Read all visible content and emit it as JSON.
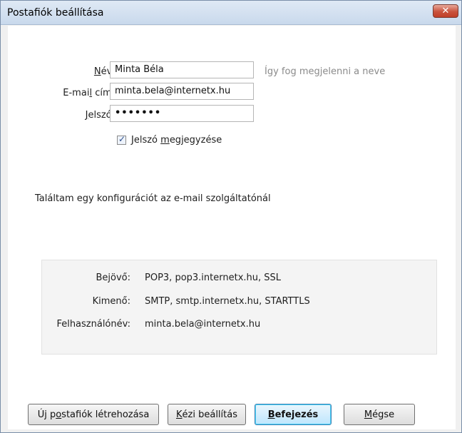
{
  "window": {
    "title": "Postafiók beállítása",
    "close_glyph": "✕"
  },
  "form": {
    "name_label_pre": "",
    "name_label_u": "N",
    "name_label_post": "év:",
    "name_value": "Minta Béla",
    "name_hint": "Így fog megjelenni a neve",
    "email_label_pre": "E-mai",
    "email_label_u": "l",
    "email_label_post": " cím:",
    "email_value": "minta.bela@internetx.hu",
    "password_label_pre": "",
    "password_label_u": "J",
    "password_label_post": "elszó:",
    "password_value": "•••••••",
    "remember_label_pre": "Jelszó ",
    "remember_label_u": "m",
    "remember_label_post": "egjegyzése",
    "remember_checked_glyph": "✓"
  },
  "status": {
    "message": "Találtam egy konfigurációt az e-mail szolgáltatónál"
  },
  "config": {
    "incoming_label": "Bejövő:",
    "incoming_value": "POP3, pop3.internetx.hu, SSL",
    "outgoing_label": "Kimenő:",
    "outgoing_value": "SMTP, smtp.internetx.hu, STARTTLS",
    "username_label": "Felhasználónév:",
    "username_value": "minta.bela@internetx.hu"
  },
  "buttons": {
    "new_account_pre": "Új p",
    "new_account_u": "o",
    "new_account_post": "stafiók létrehozása",
    "manual_pre": "",
    "manual_u": "K",
    "manual_post": "ézi beállítás",
    "finish_pre": "",
    "finish_u": "B",
    "finish_post": "efejezés",
    "cancel_pre": "",
    "cancel_u": "M",
    "cancel_post": "égse"
  }
}
